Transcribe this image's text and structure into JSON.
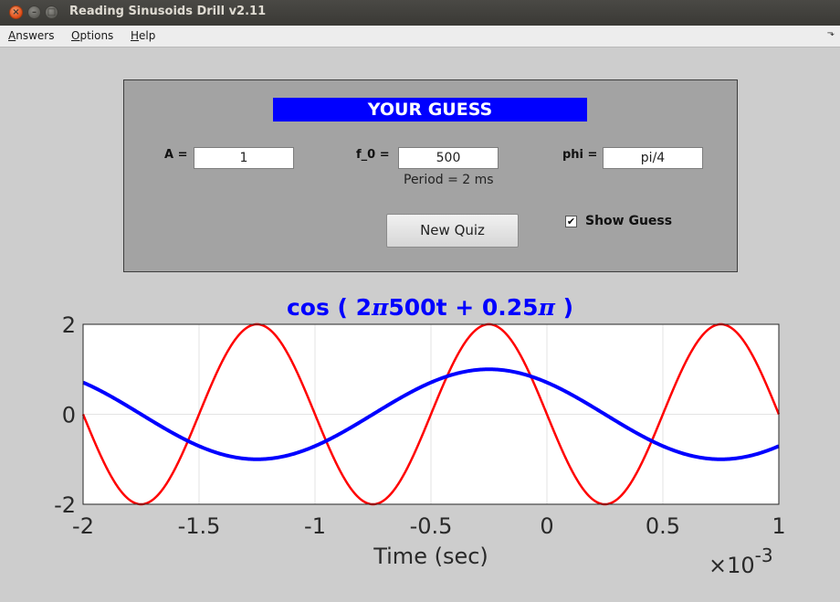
{
  "window": {
    "title": "Reading Sinusoids Drill v2.11"
  },
  "menu": {
    "items": [
      {
        "u": "A",
        "rest": "nswers"
      },
      {
        "u": "O",
        "rest": "ptions"
      },
      {
        "u": "H",
        "rest": "elp"
      }
    ]
  },
  "guess": {
    "banner": "YOUR GUESS",
    "A_label": "A =",
    "A_value": "1",
    "f0_label": "f_0 =",
    "f0_value": "500",
    "phi_label": "phi =",
    "phi_value": "pi/4",
    "period": "Period = 2 ms",
    "new_quiz": "New Quiz",
    "show_guess_label": "Show Guess",
    "show_guess_checked": true
  },
  "chart_data": {
    "type": "line",
    "title_parts": [
      "cos ( 2",
      "π",
      "500t + 0.25",
      "π",
      " )"
    ],
    "xlabel": "Time  (sec)",
    "x_scale_label": "×10",
    "x_scale_exp": "-3",
    "xlim": [
      -0.002,
      0.001
    ],
    "ylim": [
      -2,
      2
    ],
    "xticks": [
      -2,
      -1.5,
      -1,
      -0.5,
      0,
      0.5,
      1
    ],
    "yticks": [
      -2,
      0,
      2
    ],
    "grid": true,
    "series": [
      {
        "color": "#ff0000",
        "amplitude": 2,
        "frequency_hz": 1000,
        "phase_rad": 1.5708
      },
      {
        "color": "#0000ff",
        "amplitude": 1,
        "frequency_hz": 500,
        "phase_rad": 0.7854
      }
    ]
  }
}
